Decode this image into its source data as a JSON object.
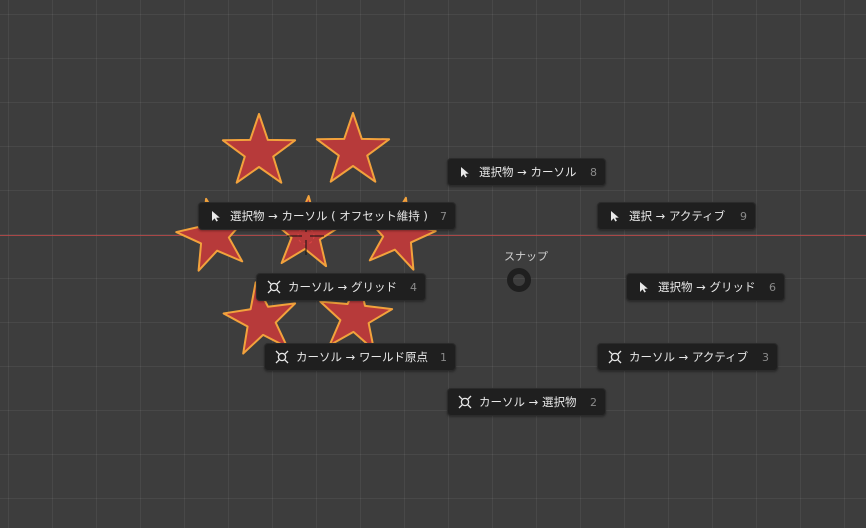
{
  "pie_menu": {
    "title": "スナップ",
    "items": [
      {
        "label": "選択物 → カーソル",
        "key": "8",
        "icon": "cursor-arrow-icon"
      },
      {
        "label": "選択物 → カーソル ( オフセット維持 )",
        "key": "7",
        "icon": "cursor-arrow-icon"
      },
      {
        "label": "選択 → アクティブ",
        "key": "9",
        "icon": "cursor-arrow-icon"
      },
      {
        "label": "カーソル → グリッド",
        "key": "4",
        "icon": "3d-cursor-icon"
      },
      {
        "label": "選択物 → グリッド",
        "key": "6",
        "icon": "cursor-arrow-icon"
      },
      {
        "label": "カーソル → ワールド原点",
        "key": "1",
        "icon": "3d-cursor-icon"
      },
      {
        "label": "カーソル → アクティブ",
        "key": "3",
        "icon": "3d-cursor-icon"
      },
      {
        "label": "カーソル → 選択物",
        "key": "2",
        "icon": "3d-cursor-icon"
      }
    ]
  },
  "colors": {
    "background": "#3d3d3d",
    "star_fill": "#b73a3a",
    "star_outline": "#f2a23c",
    "x_axis": "#b54848",
    "menu_bg": "#1f1f1f"
  }
}
